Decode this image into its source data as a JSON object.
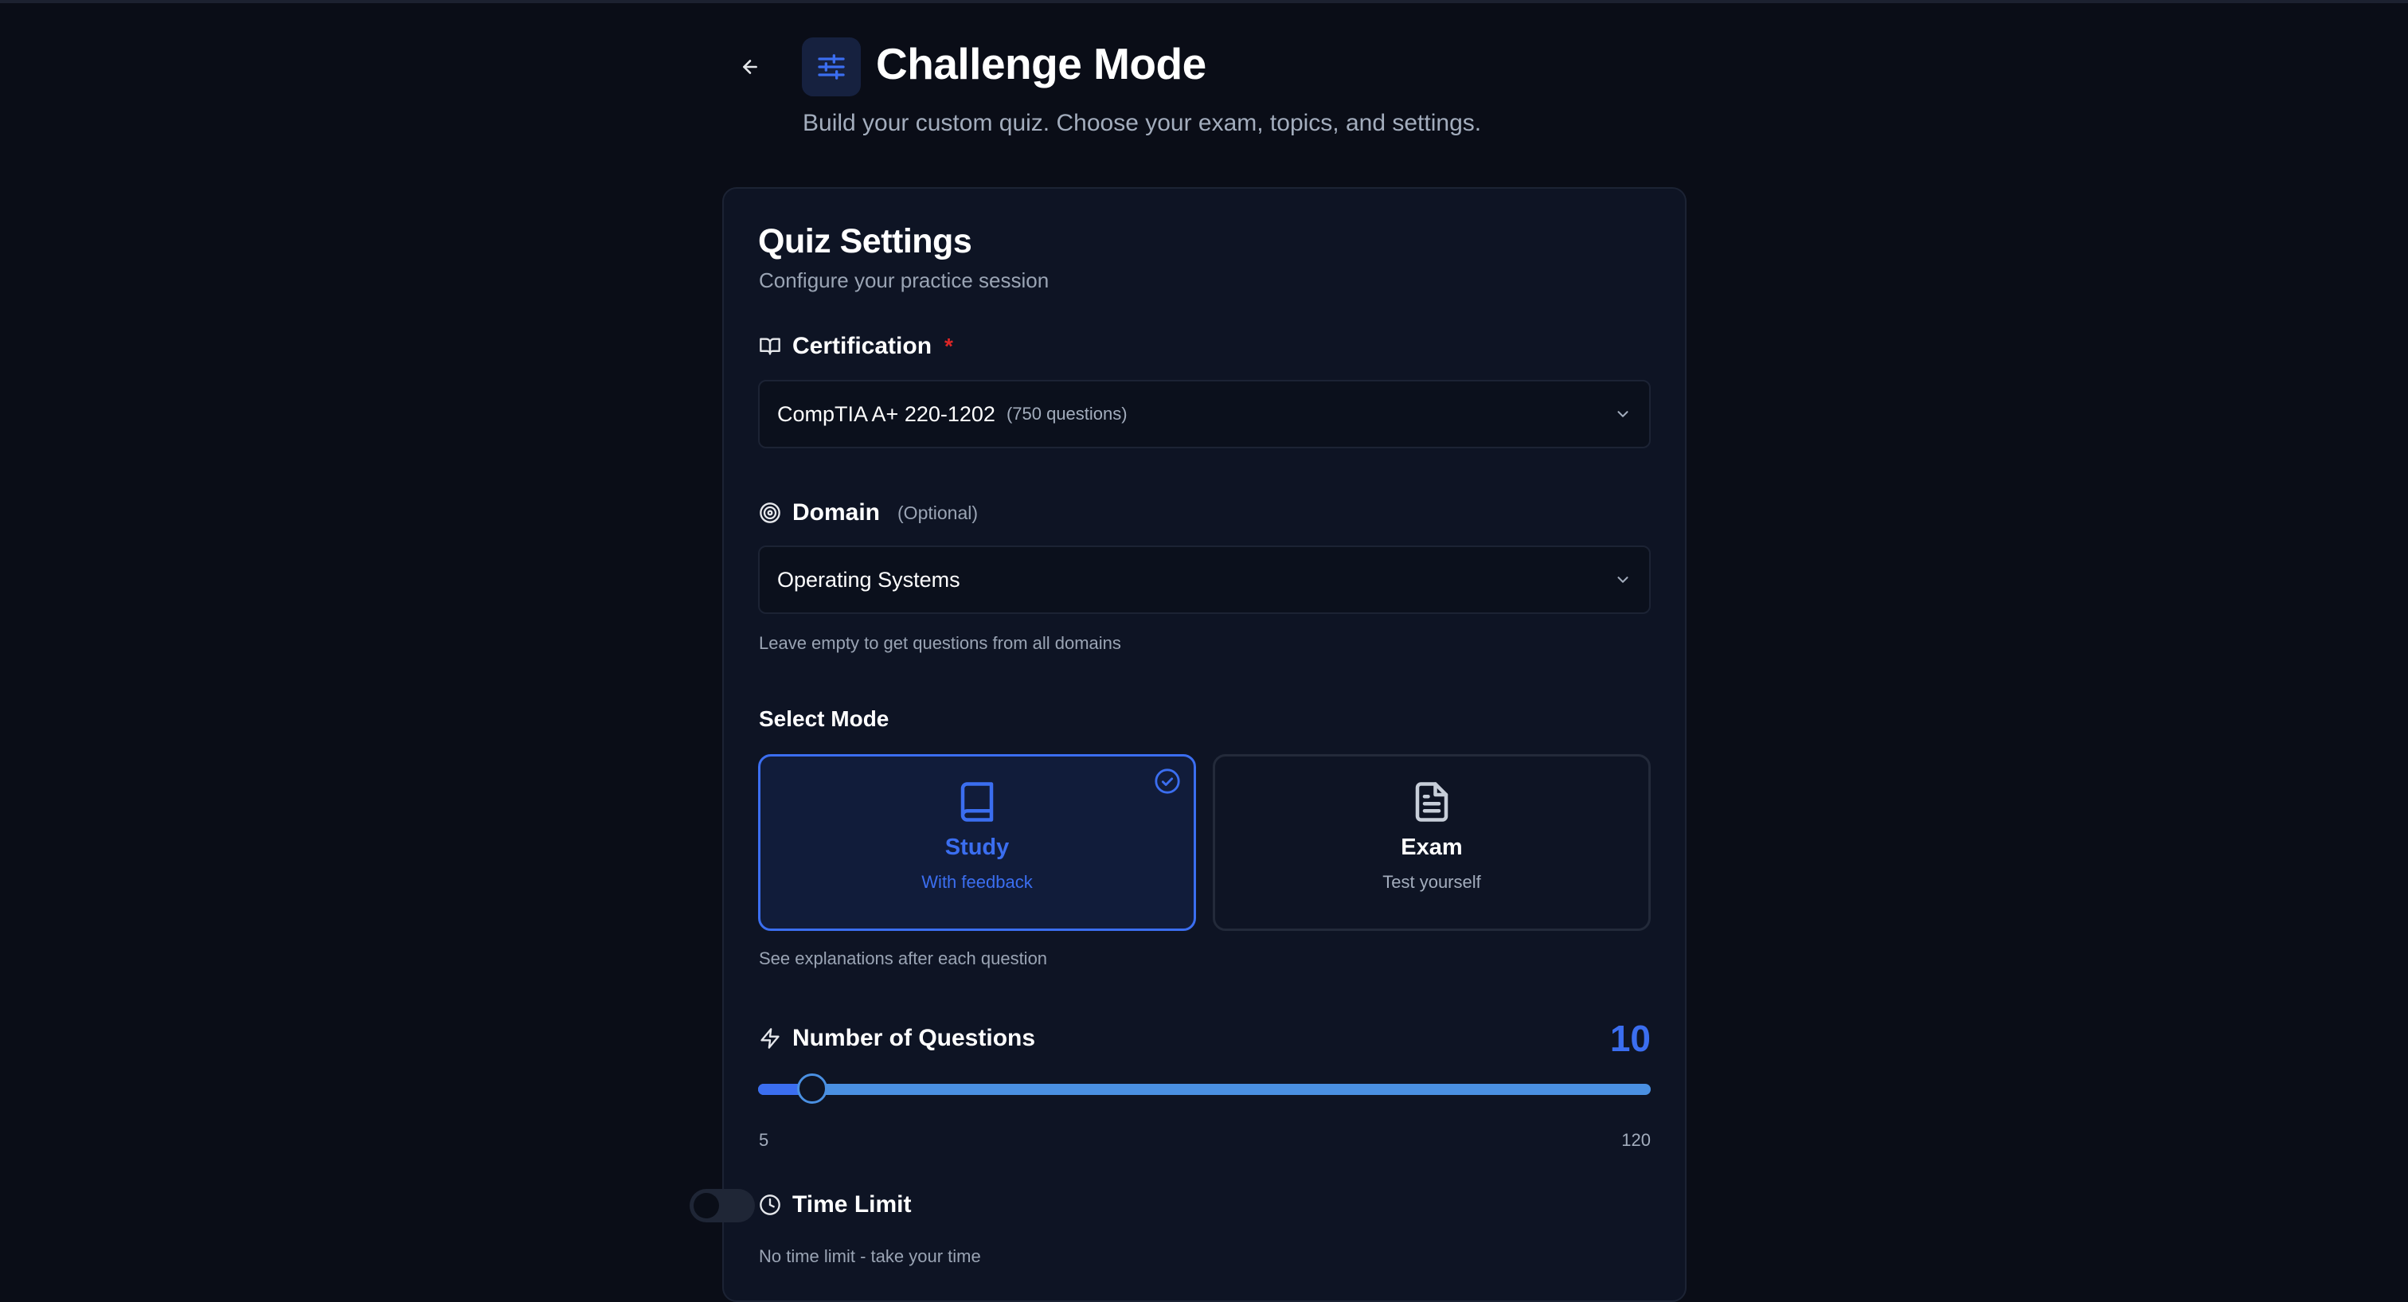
{
  "header": {
    "back_icon": "arrow-left-icon",
    "header_icon": "sliders-icon",
    "title": "Challenge Mode",
    "subtitle": "Build your custom quiz. Choose your exam, topics, and settings."
  },
  "card": {
    "title": "Quiz Settings",
    "description": "Configure your practice session"
  },
  "certification": {
    "label": "Certification",
    "required_marker": "*",
    "icon": "book-open-icon",
    "selected": "CompTIA A+ 220-1202",
    "selected_meta": "(750 questions)"
  },
  "domain": {
    "label": "Domain",
    "optional": "(Optional)",
    "icon": "target-icon",
    "selected": "Operating Systems",
    "hint": "Leave empty to get questions from all domains"
  },
  "mode": {
    "title": "Select Mode",
    "options": [
      {
        "title": "Study",
        "subtitle": "With feedback",
        "icon": "book-icon",
        "selected": true
      },
      {
        "title": "Exam",
        "subtitle": "Test yourself",
        "icon": "file-text-icon",
        "selected": false
      }
    ],
    "hint": "See explanations after each question"
  },
  "questions": {
    "label": "Number of Questions",
    "icon": "zap-icon",
    "value": "10",
    "min": "5",
    "max": "120",
    "fraction": 0.0435
  },
  "time_limit": {
    "label": "Time Limit",
    "icon": "clock-icon",
    "enabled": false,
    "hint": "No time limit - take your time"
  },
  "colors": {
    "background": "#0a0d17",
    "card": "#0e1424",
    "accent": "#3b6ef0",
    "slider_track": "#4a90e2",
    "required": "#dc2626"
  }
}
